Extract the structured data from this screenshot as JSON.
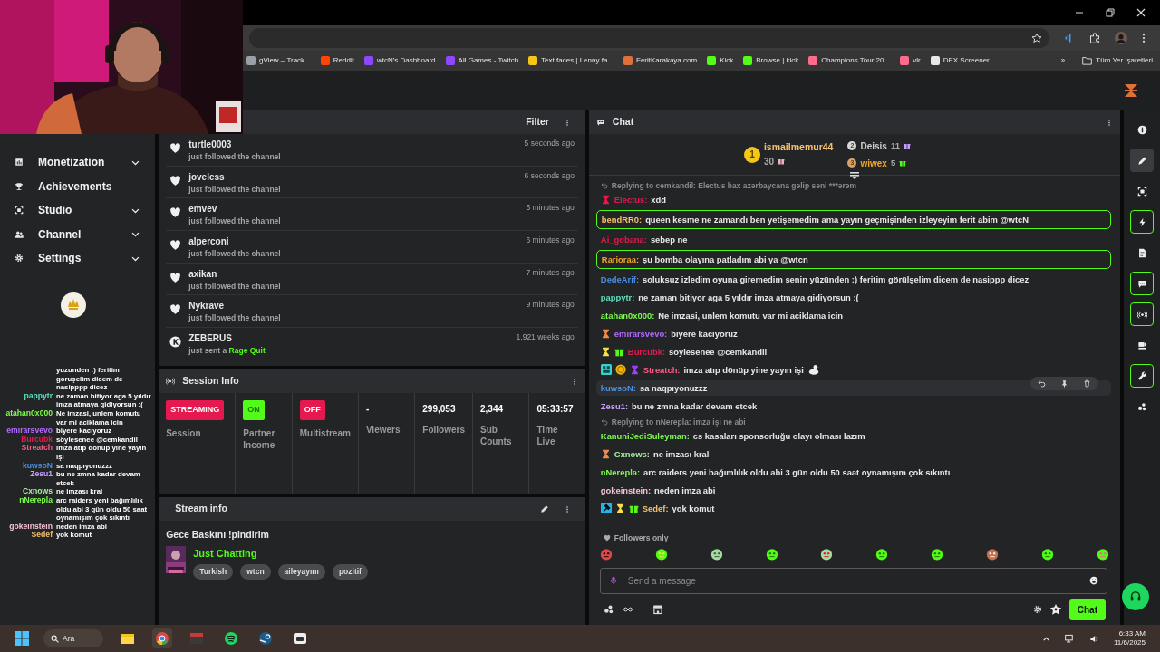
{
  "browser": {
    "bookmarks": [
      {
        "label": "gView – Track...",
        "color": "#9aa0a6"
      },
      {
        "label": "Reddit",
        "color": "#ff4500"
      },
      {
        "label": "wtcN's Dashboard",
        "color": "#9146ff"
      },
      {
        "label": "All Games - Twitch",
        "color": "#9146ff"
      },
      {
        "label": "Text faces | Lenny fa...",
        "color": "#f5c518"
      },
      {
        "label": "FeritKarakaya.com",
        "color": "#e0703a"
      },
      {
        "label": "Kick",
        "color": "#53fc18"
      },
      {
        "label": "Browse | kick",
        "color": "#53fc18"
      },
      {
        "label": "Champions Tour 20...",
        "color": "#ff6b8a"
      },
      {
        "label": "vlr",
        "color": "#ff6b8a"
      },
      {
        "label": "DEX Screener",
        "color": "#e8e8e8"
      }
    ],
    "overflow": "»",
    "all_bookmarks": "Tüm Yer İşaretleri"
  },
  "sidebar": {
    "items": [
      {
        "kind": "chart",
        "label": "Monetization",
        "expandable": true
      },
      {
        "kind": "trophy",
        "label": "Achievements",
        "expandable": false
      },
      {
        "kind": "screen",
        "label": "Studio",
        "expandable": true
      },
      {
        "kind": "users",
        "label": "Channel",
        "expandable": true
      },
      {
        "kind": "gear",
        "label": "Settings",
        "expandable": true
      }
    ]
  },
  "overlay_chat": [
    {
      "text": "yuzunden :) feritim goruşelim dicem de nasipppp dicez"
    },
    {
      "name": "pappytr",
      "color": "#5ee0c0",
      "text": "ne zaman bitiyor aga 5 yıldır imza atmaya gidiyorsun :("
    },
    {
      "name": "atahan0x000",
      "color": "#7cfc4a",
      "text": "Ne imzasi, unlem komutu var mi aciklama icin"
    },
    {
      "name": "emirarsvevo",
      "color": "#b36bff",
      "text": "biyere kacıyoruz"
    },
    {
      "name": "Burcubk",
      "color": "#e5194f",
      "text": "söylesenee @cemkandil"
    },
    {
      "name": "Streatch",
      "color": "#ff5c8a",
      "text": "imza atıp dönüp yine yayın işi"
    },
    {
      "name": "kuwsoN",
      "color": "#4a90e2",
      "text": "sa naqpıyonuzzz"
    },
    {
      "name": "Zesu1",
      "color": "#c9a0ff",
      "text": "bu ne zmna kadar devam etcek"
    },
    {
      "name": "Cxnows",
      "color": "#a8f0a0",
      "text": "ne imzası kral"
    },
    {
      "name": "nNerepla",
      "color": "#7cfc4a",
      "text": "arc raiders yeni bağımlılık oldu abi 3 gün oldu 50 saat oynamışım çok sıkıntı"
    },
    {
      "name": "gokeinstein",
      "color": "#f5c0d0",
      "text": "neden imza abi"
    },
    {
      "name": "Sedef",
      "color": "#f5c16c",
      "text": "yok komut"
    }
  ],
  "activity": {
    "filter": "Filter",
    "items": [
      {
        "kind": "follow",
        "name": "turtle0003",
        "text": "just followed the channel",
        "time": "5 seconds ago"
      },
      {
        "kind": "follow",
        "name": "joveless",
        "text": "just followed the channel",
        "time": "6 seconds ago"
      },
      {
        "kind": "follow",
        "name": "emvev",
        "text": "just followed the channel",
        "time": "5 minutes ago"
      },
      {
        "kind": "follow",
        "name": "alperconi",
        "text": "just followed the channel",
        "time": "6 minutes ago"
      },
      {
        "kind": "follow",
        "name": "axikan",
        "text": "just followed the channel",
        "time": "7 minutes ago"
      },
      {
        "kind": "follow",
        "name": "Nykrave",
        "text": "just followed the channel",
        "time": "9 minutes ago"
      },
      {
        "kind": "gift",
        "name": "ZEBERUS",
        "text": "just sent a",
        "item": "Rage Quit",
        "time": "1,921 weeks ago"
      }
    ]
  },
  "session_info": {
    "title": "Session Info",
    "stats": [
      {
        "kind": "badge",
        "value": "STREAMING",
        "color": "#e5194f",
        "label": "Session"
      },
      {
        "kind": "badge",
        "value": "ON",
        "color": "#53fc18",
        "label": "Partner Income"
      },
      {
        "kind": "badge",
        "value": "OFF",
        "color": "#e5194f",
        "label": "Multistream"
      },
      {
        "kind": "number",
        "value": "-",
        "label": "Viewers"
      },
      {
        "kind": "number",
        "value": "299,053",
        "label": "Followers"
      },
      {
        "kind": "number",
        "value": "2,344",
        "label": "Sub Counts"
      },
      {
        "kind": "number",
        "value": "05:33:57",
        "label": "Time Live"
      }
    ]
  },
  "stream_info": {
    "title": "Stream info",
    "stream_title": "Gece Baskını !pindirim",
    "category": "Just Chatting",
    "tags": [
      "Turkish",
      "wtcn",
      "aileyayını",
      "pozitif"
    ]
  },
  "chat": {
    "title": "Chat",
    "leaderboard": [
      {
        "rank": "1",
        "name": "ismailmemur44",
        "count": "30"
      },
      {
        "rank": "2",
        "name": "Deisis",
        "count": "11"
      },
      {
        "rank": "3",
        "name": "wiwex",
        "count": "5"
      }
    ],
    "messages": [
      {
        "reply_to": "Replying to cemkandil: Electus bax azərbaycana gəlip səni ***ərəm",
        "badges": [
          {
            "kind": "hourglass",
            "color": "#e5194f"
          }
        ],
        "name": "Electus:",
        "color": "#e5194f",
        "text": "xdd",
        "highlighted": false,
        "hovered": false
      },
      {
        "name": "bendRR0:",
        "color": "#f5c16c",
        "text": "queen kesme ne zamandı ben yetişemedim ama yayın geçmişinden izleyeyim ferit abim @wtcN",
        "highlighted": true,
        "hovered": false
      },
      {
        "name": "Ai_gobana:",
        "color": "#e5194f",
        "text": "sebep ne",
        "highlighted": false,
        "hovered": false
      },
      {
        "name": "Rarioraa:",
        "color": "#f5a623",
        "text": "şu bomba olayına patladım abi ya @wtcn",
        "highlighted": true,
        "hovered": false
      },
      {
        "name": "DedeArif:",
        "color": "#4a90e2",
        "text": "soluksuz izledim oyuna giremedim senin yüzünden :) feritim görülşelim dicem de nasippp dicez",
        "highlighted": false,
        "hovered": false
      },
      {
        "name": "pappytr:",
        "color": "#5ee0c0",
        "text": "ne zaman bitiyor aga 5 yıldır imza atmaya gidiyorsun :(",
        "highlighted": false,
        "hovered": false
      },
      {
        "name": "atahan0x000:",
        "color": "#7cfc4a",
        "text": "Ne imzasi, unlem komutu var mi aciklama icin",
        "highlighted": false,
        "hovered": false
      },
      {
        "badges": [
          {
            "kind": "hourglass",
            "color": "#f08a4a"
          }
        ],
        "name": "emirarsvevo:",
        "color": "#b36bff",
        "text": "biyere kacıyoruz",
        "highlighted": false,
        "hovered": false
      },
      {
        "badges": [
          {
            "kind": "hourglass",
            "color": "#f5e04a"
          },
          {
            "kind": "gift"
          }
        ],
        "name": "Burcubk:",
        "color": "#e5194f",
        "text": "söylesenee @cemkandil",
        "highlighted": false,
        "hovered": false
      },
      {
        "badges": [
          {
            "kind": "og"
          },
          {
            "kind": "coin"
          },
          {
            "kind": "hourglass",
            "color": "#9b3cff"
          }
        ],
        "name": "Streatch:",
        "color": "#ff5c8a",
        "text": "imza atıp dönüp yine yayın işi",
        "emote": true,
        "highlighted": false,
        "hovered": false
      },
      {
        "name": "kuwsoN:",
        "color": "#4a90e2",
        "text": "sa naqpıyonuzzz",
        "highlighted": false,
        "hovered": true
      },
      {
        "name": "Zesu1:",
        "color": "#c9a0ff",
        "text": "bu ne zmna kadar devam etcek",
        "highlighted": false,
        "hovered": false
      },
      {
        "reply_to": "Replying to nNerepla: imza işi ne abi",
        "name": "KanuniJediSuleyman:",
        "color": "#7cfc4a",
        "text": "cs kasaları sponsorluğu olayı olması lazım",
        "highlighted": false,
        "hovered": false
      },
      {
        "badges": [
          {
            "kind": "hourglass",
            "color": "#f08a4a"
          }
        ],
        "name": "Cxnows:",
        "color": "#a8f0a0",
        "text": "ne imzası kral",
        "highlighted": false,
        "hovered": false
      },
      {
        "name": "nNerepla:",
        "color": "#7cfc4a",
        "text": "arc raiders yeni bağımlılık oldu abi 3 gün oldu 50 saat oynamışım çok sıkıntı",
        "highlighted": false,
        "hovered": false
      },
      {
        "name": "gokeinstein:",
        "color": "#f5c0d0",
        "text": "neden imza abi",
        "highlighted": false,
        "hovered": false
      },
      {
        "badges": [
          {
            "kind": "hammer"
          },
          {
            "kind": "hourglass",
            "color": "#f5e04a"
          },
          {
            "kind": "gift"
          }
        ],
        "name": "Sedef:",
        "color": "#f5c16c",
        "text": "yok komut",
        "highlighted": false,
        "hovered": false
      }
    ],
    "followers_only": "Followers only",
    "emotes": [
      {
        "kind": "angry"
      },
      {
        "kind": "halo"
      },
      {
        "kind": "goggles"
      },
      {
        "kind": "grin"
      },
      {
        "kind": "headset"
      },
      {
        "kind": "smile"
      },
      {
        "kind": "blob"
      },
      {
        "kind": "monkey"
      },
      {
        "kind": "sick"
      },
      {
        "kind": "love"
      }
    ],
    "input": {
      "placeholder": "Send a message"
    },
    "send": "Chat"
  },
  "rail": [
    {
      "kind": "info",
      "selected": false,
      "highlighted": false
    },
    {
      "kind": "pencil",
      "selected": true,
      "highlighted": false
    },
    {
      "kind": "screen",
      "selected": false,
      "highlighted": false
    },
    {
      "kind": "bolt",
      "selected": false,
      "highlighted": true
    },
    {
      "kind": "doc",
      "selected": false,
      "highlighted": false
    },
    {
      "kind": "chat",
      "selected": false,
      "highlighted": true
    },
    {
      "kind": "broadcast",
      "selected": false,
      "highlighted": true
    },
    {
      "kind": "camera",
      "selected": false,
      "highlighted": false
    },
    {
      "kind": "wrench",
      "selected": false,
      "highlighted": true
    },
    {
      "kind": "dots",
      "selected": false,
      "highlighted": false
    }
  ],
  "taskbar": {
    "search": "Ara",
    "apps": [
      {
        "kind": "explorer",
        "selected": false
      },
      {
        "kind": "chrome",
        "selected": true
      },
      {
        "kind": "voicemeeter",
        "selected": false
      },
      {
        "kind": "spotify",
        "selected": false
      },
      {
        "kind": "steam",
        "selected": false
      },
      {
        "kind": "app",
        "selected": false
      }
    ],
    "time": "6:33 AM",
    "date": "11/6/2025"
  }
}
